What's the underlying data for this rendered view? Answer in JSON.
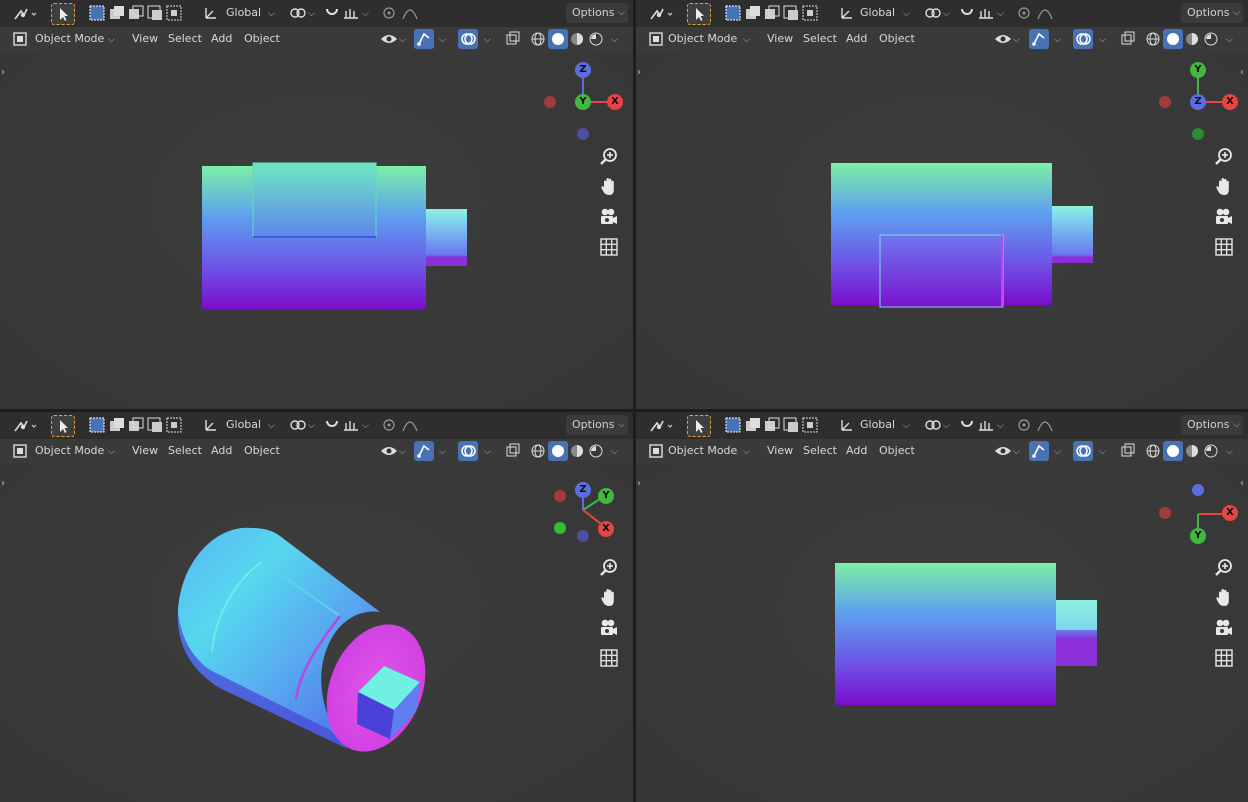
{
  "toolbar": {
    "transform_orientation": "Global",
    "options_label": "Options",
    "mode_label": "Object Mode",
    "menu": {
      "view": "View",
      "select": "Select",
      "add": "Add",
      "object": "Object"
    }
  },
  "gizmo_labels": {
    "x": "X",
    "y": "Y",
    "z": "Z"
  },
  "colors": {
    "x_axis": "#e84444",
    "y_axis": "#42b742",
    "z_axis": "#5a6ee0",
    "accent_blue": "#4772b3",
    "select_orange": "#f0a030"
  },
  "icons": {
    "zoom": "zoom-icon",
    "pan": "hand-pan-icon",
    "camera": "camera-view-icon",
    "grid": "ortho-grid-icon"
  }
}
